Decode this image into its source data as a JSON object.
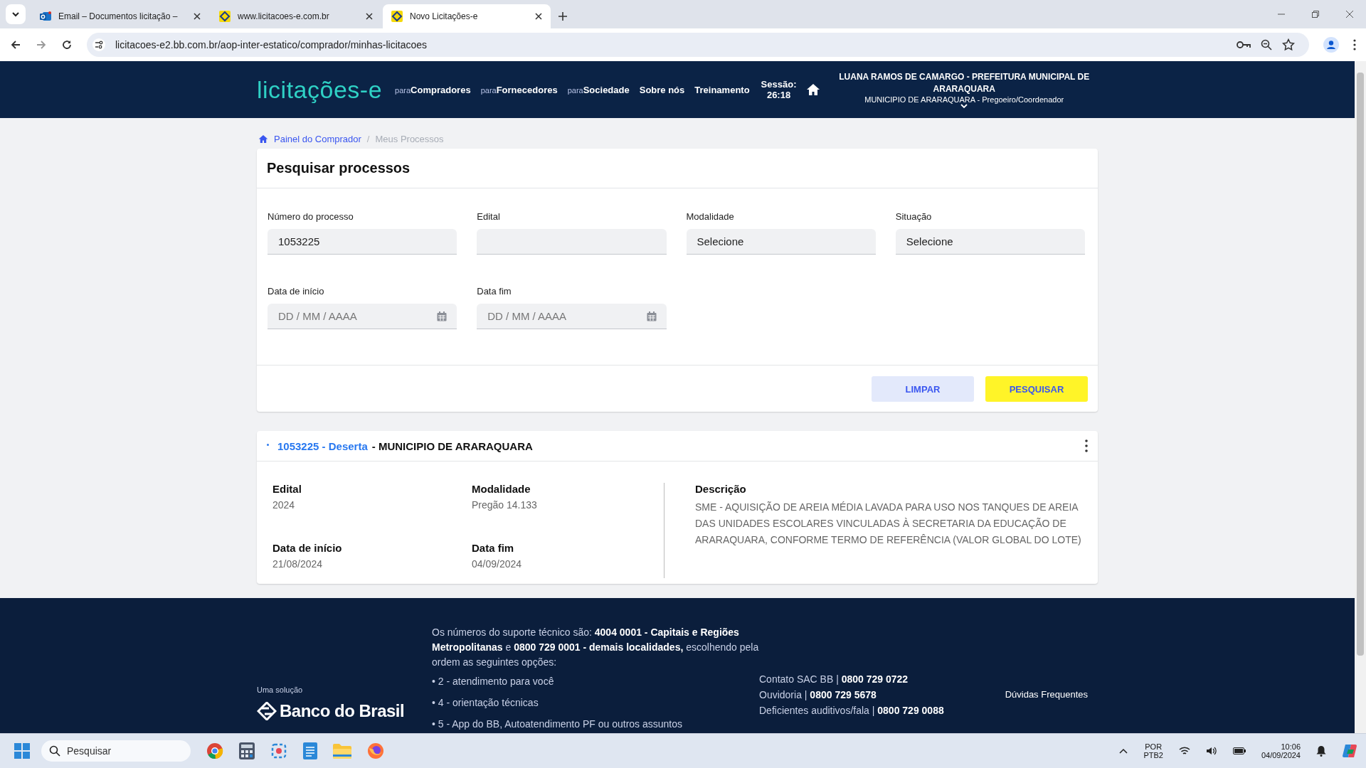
{
  "browser": {
    "tabs": [
      {
        "title": "Email – Documentos licitação –",
        "kind": "mail",
        "selected": false
      },
      {
        "title": "www.licitacoes-e.com.br",
        "kind": "bb",
        "selected": false
      },
      {
        "title": "Novo Licitações-e",
        "kind": "bb",
        "selected": true
      }
    ],
    "url": "licitacoes-e2.bb.com.br/aop-inter-estatico/comprador/minhas-licitacoes"
  },
  "header": {
    "logo": "licitações-e",
    "nav": [
      {
        "prefix": "para",
        "label": "Compradores"
      },
      {
        "prefix": "para",
        "label": "Fornecedores"
      },
      {
        "prefix": "para",
        "label": "Sociedade"
      },
      {
        "label": "Sobre nós"
      },
      {
        "label": "Treinamento"
      }
    ],
    "session_label": "Sessão:",
    "session_time": "26:18",
    "user_name": "LUANA RAMOS DE CAMARGO - PREFEITURA MUNICIPAL DE ARARAQUARA",
    "user_role": "MUNICIPIO DE ARARAQUARA - Pregoeiro/Coordenador"
  },
  "breadcrumb_separator": "/",
  "breadcrumb": [
    {
      "label": "Painel do Comprador",
      "selected": false
    },
    {
      "label": "Meus Processos",
      "selected": true
    }
  ],
  "search": {
    "title": "Pesquisar processos",
    "fields": [
      {
        "label": "Número do processo",
        "kind": "text",
        "value": "1053225"
      },
      {
        "label": "Edital",
        "kind": "text"
      },
      {
        "label": "Modalidade",
        "kind": "select",
        "value": "Selecione"
      },
      {
        "label": "Situação",
        "kind": "select",
        "value": "Selecione"
      },
      {
        "label": "Data de início",
        "kind": "date",
        "placeholder": "DD / MM / AAAA"
      },
      {
        "label": "Data fim",
        "kind": "date",
        "placeholder": "DD / MM / AAAA"
      }
    ],
    "buttons": [
      {
        "label": "LIMPAR",
        "kind": "secondary"
      },
      {
        "label": "PESQUISAR",
        "kind": "primary"
      }
    ]
  },
  "result": {
    "number": "1053225",
    "separator": "-",
    "status": "Deserta",
    "entity": "- MUNICIPIO DE ARARAQUARA",
    "details": [
      {
        "label": "Edital",
        "value": "2024"
      },
      {
        "label": "Modalidade",
        "value": "Pregão 14.133"
      },
      {
        "label": "Data de início",
        "value": "21/08/2024"
      },
      {
        "label": "Data fim",
        "value": "04/09/2024"
      }
    ],
    "description_label": "Descrição",
    "description": "SME - AQUISIÇÃO DE AREIA MÉDIA LAVADA PARA USO NOS TANQUES DE AREIA DAS UNIDADES ESCOLARES VINCULADAS À SECRETARIA DA EDUCAÇÃO DE ARARAQUARA, CONFORME TERMO DE REFERÊNCIA (VALOR GLOBAL DO LOTE)"
  },
  "footer": {
    "solution_label": "Uma solução",
    "brand": "Banco do Brasil",
    "support_text": "Os números do suporte técnico são: **4004 0001 - Capitais e Regiões Metropolitanas** e **0800 729 0001 - demais localidades,** escolhendo pela ordem as seguintes opções:",
    "options": [
      "• 2 - atendimento para você",
      "• 4 - orientação técnicas",
      "• 5 - App do BB, Autoatendimento PF ou outros assuntos"
    ],
    "contacts": [
      "Contato SAC BB | **0800 729 0722**",
      "Ouvidoria | **0800 729 5678**",
      "Deficientes auditivos/fala | **0800 729 0088**"
    ],
    "faq": "Dúvidas Frequentes"
  },
  "taskbar": {
    "search_placeholder": "Pesquisar",
    "language": "POR",
    "layout": "PTB2",
    "time": "10:06",
    "date": "04/09/2024"
  }
}
